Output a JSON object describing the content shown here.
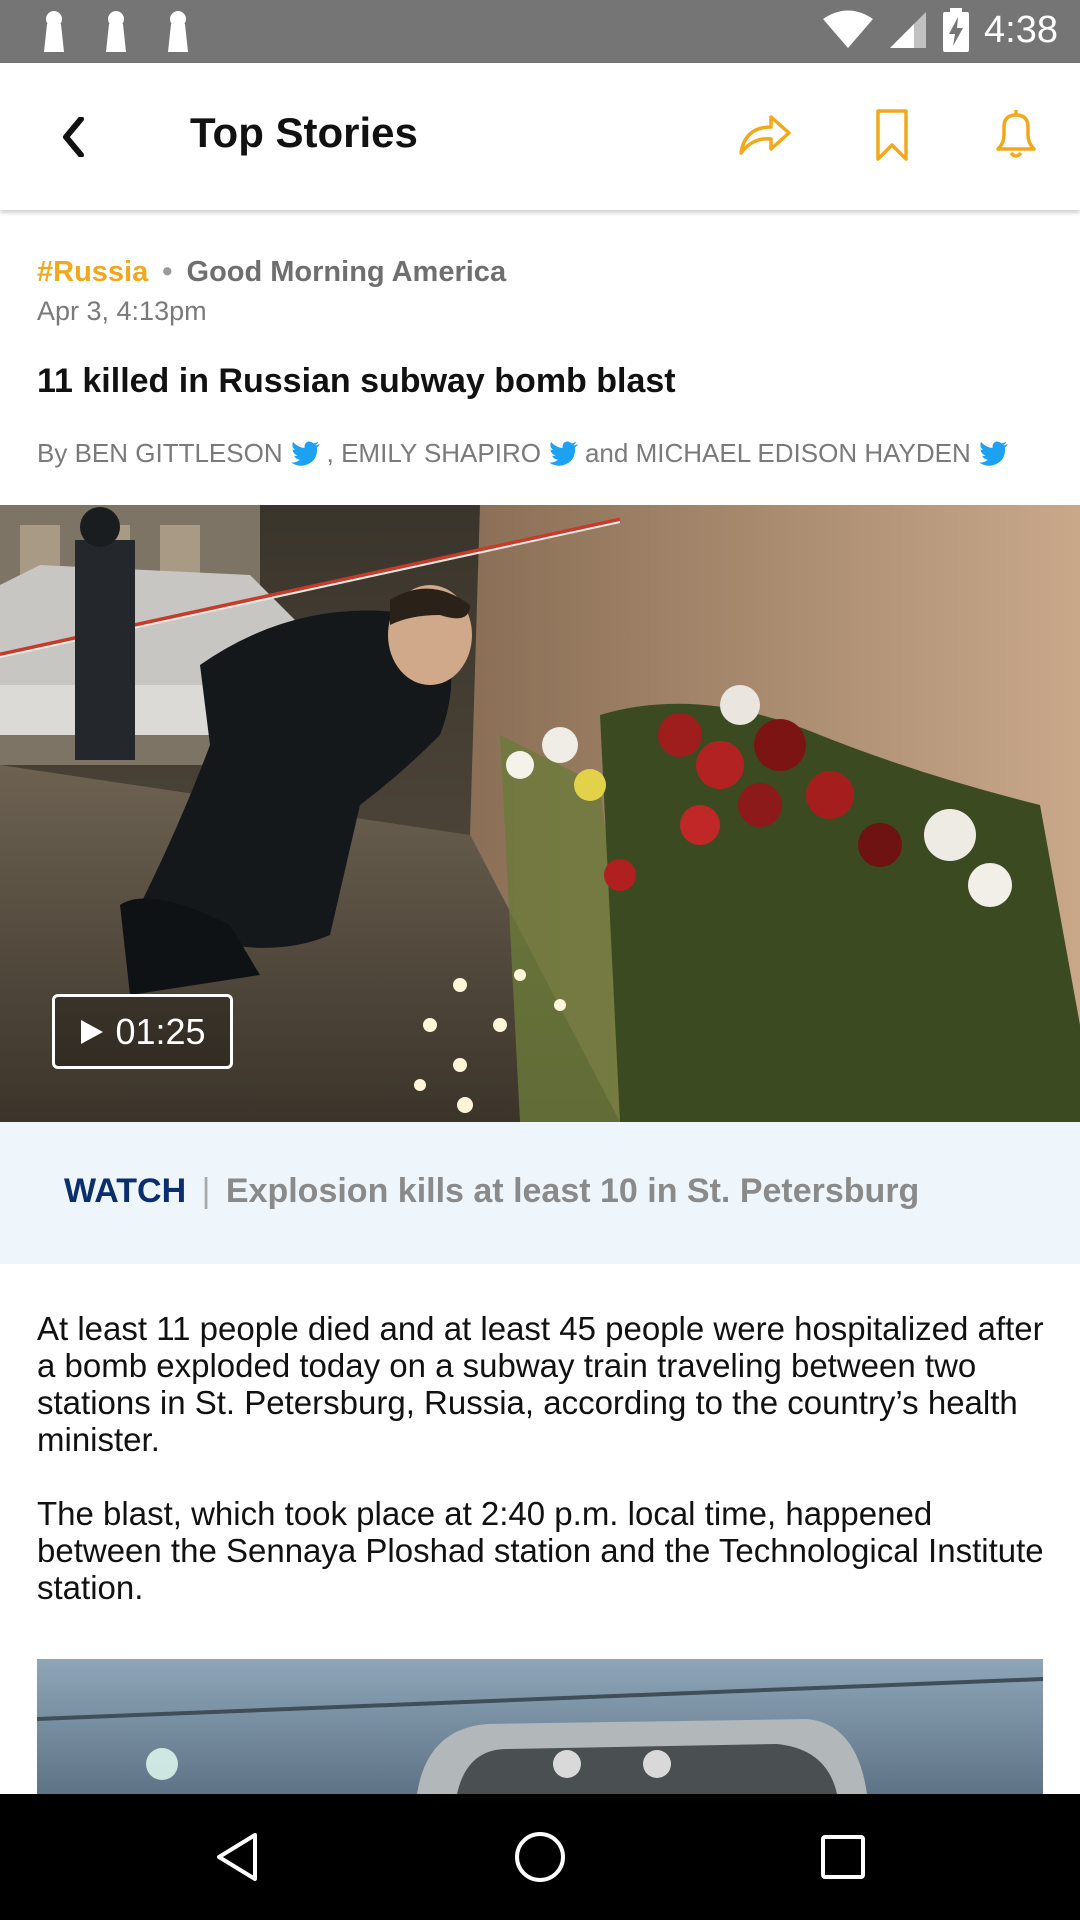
{
  "status_bar": {
    "time": "4:38",
    "left_icons": [
      "notification-icon",
      "notification-icon",
      "notification-icon"
    ],
    "right_icons": [
      "wifi-icon",
      "cell-signal-icon",
      "battery-charging-icon"
    ]
  },
  "app_bar": {
    "title": "Top Stories",
    "back_icon": "chevron-left-icon",
    "action_icons": [
      "share-icon",
      "bookmark-icon",
      "bell-icon"
    ],
    "accent_color": "#f2a81d"
  },
  "article": {
    "tag": "#Russia",
    "source": "Good Morning America",
    "separator": "•",
    "date": "Apr 3, 4:13pm",
    "headline": "11 killed in Russian subway bomb blast",
    "byline": {
      "prefix": "By",
      "authors": [
        "BEN GITTLESON",
        "EMILY SHAPIRO",
        "MICHAEL EDISON HAYDEN"
      ],
      "comma": ",",
      "and": "and"
    },
    "video": {
      "duration": "01:25"
    },
    "watch": {
      "label": "WATCH",
      "divider": "|",
      "text": "Explosion kills at least 10 in St. Petersburg"
    },
    "paragraphs": [
      "At least 11 people died and at least 45 people were hospitalized after a bomb exploded today on a subway train traveling between two stations in St. Petersburg, Russia, according to the country’s health minister.",
      "The blast, which took place at 2:40 p.m. local time, happened between the Sennaya Ploshad station and the Technological Institute station."
    ]
  },
  "nav_bar": {
    "buttons": [
      "back-triangle-icon",
      "home-circle-icon",
      "recents-square-icon"
    ]
  }
}
